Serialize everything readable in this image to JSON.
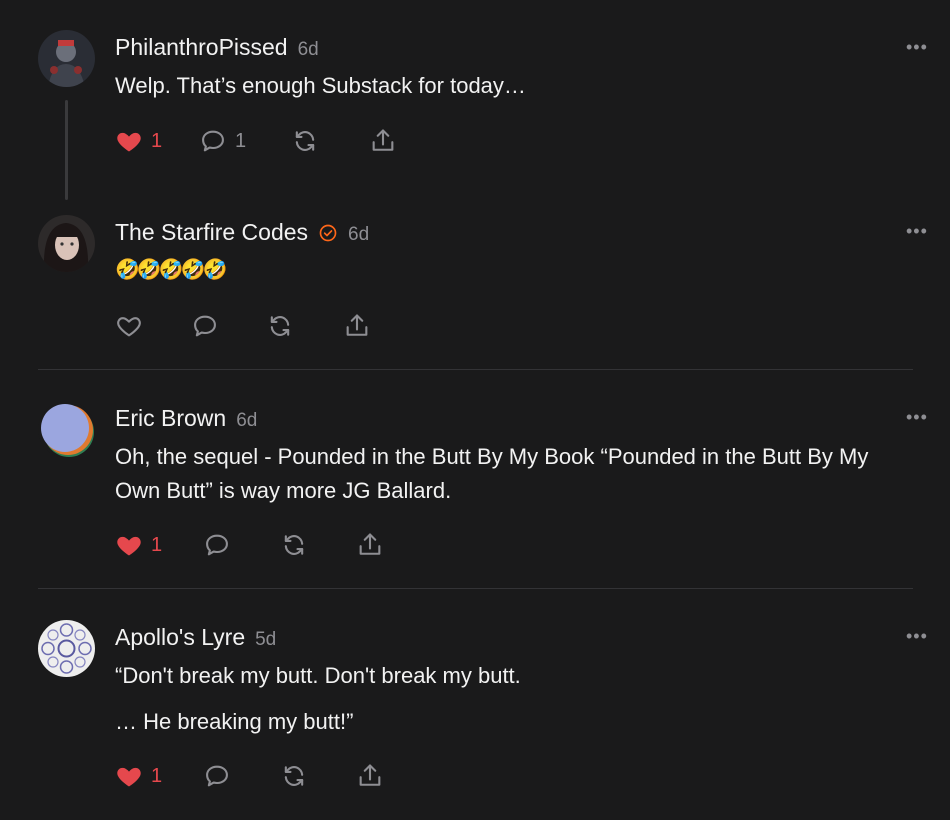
{
  "colors": {
    "background": "#1a1a1b",
    "text": "#f2f2f2",
    "muted": "#8e8e93",
    "like": "#e5484d",
    "verified": "#ff6719"
  },
  "icons": [
    "heart-icon",
    "comment-icon",
    "restack-icon",
    "share-icon",
    "more-icon",
    "verified-icon"
  ],
  "comments": [
    {
      "author": "PhilanthroPissed",
      "time": "6d",
      "text": "Welp. That’s enough Substack for today…",
      "likes": "1",
      "liked": true,
      "replies": "1",
      "more": "•••"
    },
    {
      "author": "The Starfire Codes",
      "time": "6d",
      "text": "🤣🤣🤣🤣🤣",
      "verified": true,
      "liked": false,
      "more": "•••"
    },
    {
      "author": "Eric Brown",
      "time": "6d",
      "text": "Oh, the sequel - Pounded in the Butt By My Book “Pounded in the Butt By My Own Butt” is way more JG Ballard.",
      "likes": "1",
      "liked": true,
      "more": "•••"
    },
    {
      "author": "Apollo's Lyre",
      "time": "5d",
      "text_line1": "“Don't break my butt. Don't break my butt.",
      "text_line2": "… He breaking my butt!”",
      "likes": "1",
      "liked": true,
      "more": "•••"
    }
  ]
}
